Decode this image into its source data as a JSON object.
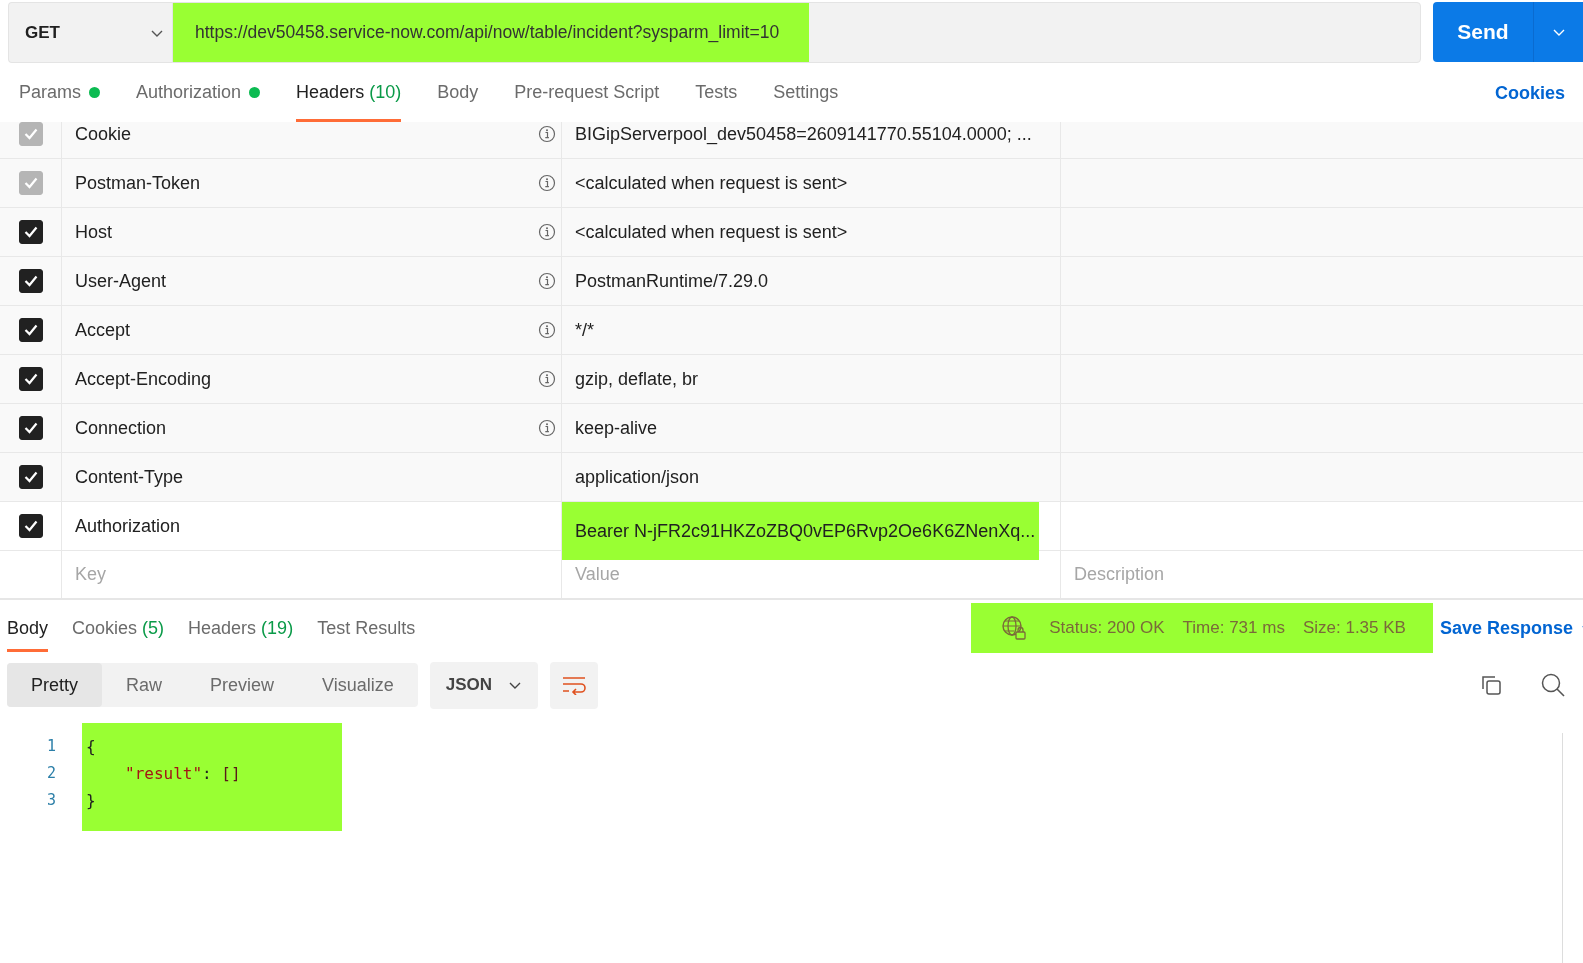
{
  "request": {
    "method": "GET",
    "url": "https://dev50458.service-now.com/api/now/table/incident?sysparm_limit=10",
    "url_highlighted": true,
    "send_label": "Send"
  },
  "request_tabs": [
    {
      "label": "Params",
      "color": "#0cbb52",
      "selected": false
    },
    {
      "label": "Authorization",
      "color": "#0cbb52",
      "selected": false
    },
    {
      "label": "Headers",
      "count": "(10)",
      "selected": true
    },
    {
      "label": "Body",
      "selected": false
    },
    {
      "label": "Pre-request Script",
      "selected": false
    },
    {
      "label": "Tests",
      "selected": false
    },
    {
      "label": "Settings",
      "selected": false
    }
  ],
  "cookies_link": "Cookies",
  "headers": [
    {
      "key": "Cookie",
      "value": "BIGipServerpool_dev50458=2609141770.55104.0000; ...",
      "checked": true,
      "disabled": true,
      "info": true,
      "highlighted": false
    },
    {
      "key": "Postman-Token",
      "value": "<calculated when request is sent>",
      "checked": true,
      "disabled": true,
      "info": true,
      "highlighted": false
    },
    {
      "key": "Host",
      "value": "<calculated when request is sent>",
      "checked": true,
      "disabled": false,
      "info": true,
      "highlighted": false
    },
    {
      "key": "User-Agent",
      "value": "PostmanRuntime/7.29.0",
      "checked": true,
      "disabled": false,
      "info": true,
      "highlighted": false
    },
    {
      "key": "Accept",
      "value": "*/*",
      "checked": true,
      "disabled": false,
      "info": true,
      "highlighted": false
    },
    {
      "key": "Accept-Encoding",
      "value": "gzip, deflate, br",
      "checked": true,
      "disabled": false,
      "info": true,
      "highlighted": false
    },
    {
      "key": "Connection",
      "value": "keep-alive",
      "checked": true,
      "disabled": false,
      "info": true,
      "highlighted": false
    },
    {
      "key": "Content-Type",
      "value": "application/json",
      "checked": true,
      "disabled": false,
      "info": false,
      "highlighted": false
    },
    {
      "key": "Authorization",
      "value": "Bearer N-jFR2c91HKZoZBQ0vEP6Rvp2Oe6K6ZNenXq...",
      "checked": true,
      "disabled": false,
      "info": false,
      "highlighted": true
    }
  ],
  "new_header": {
    "key_placeholder": "Key",
    "value_placeholder": "Value",
    "description_placeholder": "Description"
  },
  "response_tabs": [
    {
      "label": "Body",
      "selected": true
    },
    {
      "label": "Cookies",
      "count": "(5)",
      "selected": false
    },
    {
      "label": "Headers",
      "count": "(19)",
      "selected": false
    },
    {
      "label": "Test Results",
      "selected": false
    }
  ],
  "response_status": {
    "highlighted": true,
    "status": "Status: 200 OK",
    "time": "Time: 731 ms",
    "size": "Size: 1.35 KB"
  },
  "save_response": "Save Response",
  "view_modes": [
    {
      "label": "Pretty",
      "selected": true
    },
    {
      "label": "Raw",
      "selected": false
    },
    {
      "label": "Preview",
      "selected": false
    },
    {
      "label": "Visualize",
      "selected": false
    }
  ],
  "format": "JSON",
  "code": {
    "highlighted": true,
    "lines": [
      {
        "number": "1",
        "indented": false,
        "tokens": [
          {
            "kind": "bracket",
            "text": "{"
          }
        ]
      },
      {
        "number": "2",
        "indented": true,
        "tokens": [
          {
            "kind": "key",
            "text": "\"result\""
          },
          {
            "kind": "punct",
            "text": ": "
          },
          {
            "kind": "array",
            "text": "[]"
          }
        ]
      },
      {
        "number": "3",
        "indented": false,
        "tokens": [
          {
            "kind": "bracket",
            "text": "}"
          }
        ]
      }
    ]
  }
}
